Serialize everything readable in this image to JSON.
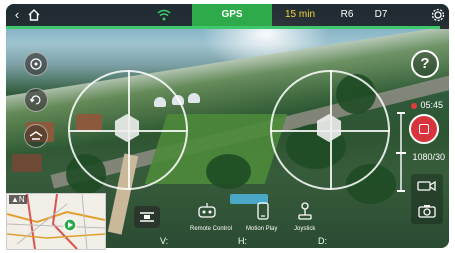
{
  "topbar": {
    "back_icon": "chevron-left-icon",
    "home_icon": "home-icon",
    "wifi_icon": "wifi-signal-icon",
    "gps_label": "GPS",
    "flight_time": "15 min",
    "signal_r": "R6",
    "signal_d": "D7",
    "settings_icon": "gear-icon",
    "flight_time_progress": 0.98
  },
  "left_controls": {
    "button1_icon": "compass-calibrate-icon",
    "button2_icon": "return-home-icon",
    "button3_icon": "takeoff-land-icon"
  },
  "right_panel": {
    "help_label": "?",
    "record_time": "05:45",
    "resolution": "1080/30",
    "video_icon": "video-camera-icon",
    "photo_icon": "photo-camera-icon"
  },
  "bottom": {
    "drone_button_icon": "drone-icon",
    "remote_control_label": "Remote Control",
    "motion_play_label": "Motion Play",
    "joystick_label": "Joystick",
    "telemetry_v": "V:",
    "telemetry_h": "H:",
    "telemetry_d": "D:"
  },
  "map": {
    "north_label": "▲N",
    "marker_icon": "location-marker-icon"
  },
  "colors": {
    "gps_active": "#2faa4b",
    "flight_time": "#f1d53a",
    "record_red": "#d8343e"
  }
}
